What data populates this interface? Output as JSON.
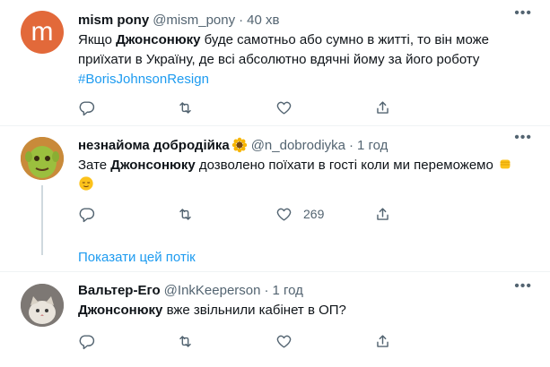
{
  "tweets": [
    {
      "avatar_letter": "m",
      "name": "mism pony",
      "handle": "@mism_pony",
      "time": "40 хв",
      "text_before": "Якщо ",
      "text_bold": "Джонсонюку",
      "text_after": " буде самотньо або сумно в житті, то він може приїхати в Україну, де всі абсолютно вдячні йому за його роботу",
      "hashtag": "#BorisJohnsonResign"
    },
    {
      "name": "незнайома добродійка",
      "handle": "@n_dobrodiyka",
      "time": "1 год",
      "text_before": "Зате ",
      "text_bold": "Джонсонюку",
      "text_after": " дозволено поїхати в гості коли ми переможемо",
      "like_count": "269",
      "show_thread": "Показати цей потік"
    },
    {
      "name": "Вальтер-Его",
      "handle": "@InkKeeperson",
      "time": "1 год",
      "text_bold": "Джонсонюку",
      "text_after": " вже звільнили кабінет в ОП?"
    }
  ],
  "dot": "·",
  "more": "•••",
  "colors": {
    "link": "#1d9bf0",
    "muted": "#536471",
    "text": "#0f1419"
  },
  "icons": [
    "reply-icon",
    "retweet-icon",
    "like-icon",
    "share-icon",
    "more-icon"
  ]
}
